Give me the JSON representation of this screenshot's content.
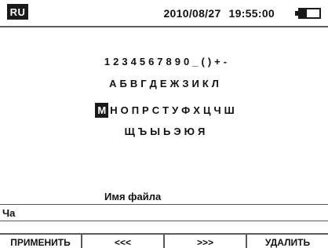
{
  "status": {
    "language": "RU",
    "date": "2010/08/27",
    "time": "19:55:00",
    "battery_level": 0.35
  },
  "keyboard": {
    "rows": [
      [
        "1",
        "2",
        "3",
        "4",
        "5",
        "6",
        "7",
        "8",
        "9",
        "0",
        "_",
        "(",
        ")",
        "+",
        "-"
      ],
      [
        "А",
        "Б",
        "В",
        "Г",
        "Д",
        "Е",
        "Ж",
        "З",
        "И",
        "К",
        "Л"
      ],
      [
        "М",
        "Н",
        "О",
        "П",
        "Р",
        "С",
        "Т",
        "У",
        "Ф",
        "Х",
        "Ц",
        "Ч",
        "Ш"
      ],
      [
        "Щ",
        "Ъ",
        "Ы",
        "Ь",
        "Э",
        "Ю",
        "Я"
      ]
    ],
    "selected": "М"
  },
  "filename": {
    "label": "Имя файла",
    "value": "Ча"
  },
  "softkeys": [
    {
      "label": "ПРИМЕНИТЬ"
    },
    {
      "label": "<<<"
    },
    {
      "label": ">>>"
    },
    {
      "label": "УДАЛИТЬ"
    }
  ]
}
